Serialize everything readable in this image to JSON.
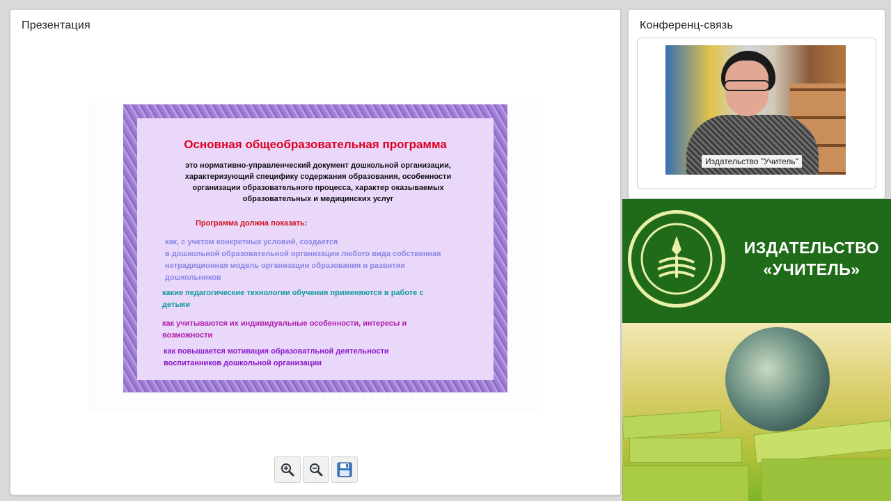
{
  "presentation": {
    "title": "Презентация",
    "slide": {
      "title": "Основная общеобразовательная программа",
      "definition_lines": [
        "это нормативно-управленческий документ дошкольной организации,",
        "характеризующий специфику содержания образования, особенности",
        "организации образовательного процесса, характер оказываемых",
        "образовательных и медицинских услуг"
      ],
      "subtitle": "Программа должна показать:",
      "items": [
        {
          "lines": [
            "как, с учетом конкретных условий, создается",
            "в дошкольной образовательной организации любого вида собственная",
            "нетрадиционная модель организации образования и развития",
            "дошкольников"
          ],
          "color": "#8a86e6"
        },
        {
          "lines": [
            "какие педагогические технологии обучения применяются в работе с",
            "детьми"
          ],
          "color": "#0f9b9b"
        },
        {
          "lines": [
            "как учитываются их индивидуальные особенности, интересы и",
            "возможности"
          ],
          "color": "#b01aa8"
        },
        {
          "lines": [
            "как повышается мотивация образоватльной деятельности",
            "воспитанников дошкольной организации"
          ],
          "color": "#8a18c8"
        }
      ]
    },
    "toolbar": {
      "zoom_in_icon": "zoom-in-icon",
      "zoom_out_icon": "zoom-out-icon",
      "save_icon": "floppy-disk-icon"
    }
  },
  "conference": {
    "title": "Конференц-связь",
    "video_caption": "Издательство \"Учитель\""
  },
  "brand": {
    "name_line1": "ИЗДАТЕЛЬСТВО",
    "name_line2": "«УЧИТЕЛЬ»",
    "color": "#1f6b19"
  }
}
